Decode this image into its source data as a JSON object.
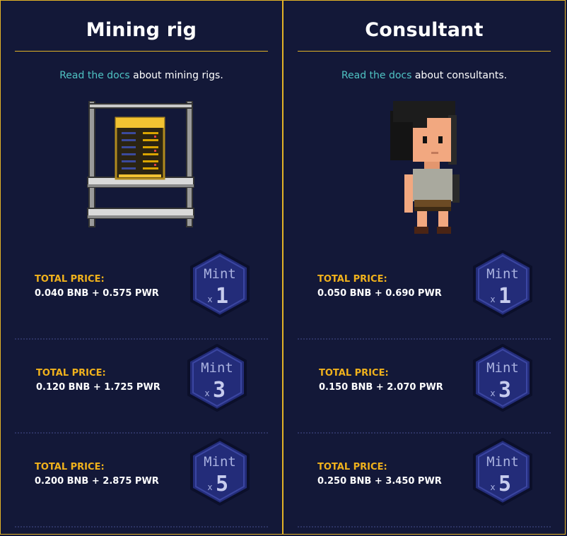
{
  "panels": [
    {
      "title": "Mining rig",
      "docs_link": "Read the docs",
      "docs_text": " about mining rigs.",
      "image_name": "mining-rig-image",
      "rows": [
        {
          "label": "TOTAL PRICE:",
          "value": "0.040 BNB + 0.575 PWR",
          "mint": "Mint",
          "x": "x",
          "qty": "1"
        },
        {
          "label": "TOTAL PRICE:",
          "value": "0.120 BNB + 1.725 PWR",
          "mint": "Mint",
          "x": "x",
          "qty": "3"
        },
        {
          "label": "TOTAL PRICE:",
          "value": "0.200 BNB + 2.875 PWR",
          "mint": "Mint",
          "x": "x",
          "qty": "5"
        }
      ]
    },
    {
      "title": "Consultant",
      "docs_link": "Read the docs",
      "docs_text": " about consultants.",
      "image_name": "consultant-image",
      "rows": [
        {
          "label": "TOTAL PRICE:",
          "value": "0.050 BNB + 0.690 PWR",
          "mint": "Mint",
          "x": "x",
          "qty": "1"
        },
        {
          "label": "TOTAL PRICE:",
          "value": "0.150 BNB + 2.070 PWR",
          "mint": "Mint",
          "x": "x",
          "qty": "3"
        },
        {
          "label": "TOTAL PRICE:",
          "value": "0.250 BNB + 3.450 PWR",
          "mint": "Mint",
          "x": "x",
          "qty": "5"
        }
      ]
    }
  ],
  "colors": {
    "background": "#131838",
    "border_gold": "#e2b227",
    "price_label": "#f1b21c",
    "link": "#4fc3c3",
    "hex_fill": "#232c79",
    "hex_border": "#0b0f2a"
  }
}
